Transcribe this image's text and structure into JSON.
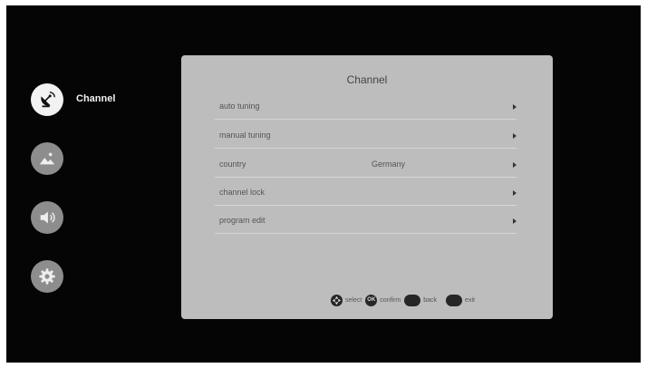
{
  "sidebar": {
    "items": [
      {
        "label": "Channel",
        "icon": "satellite-dish-icon",
        "active": true
      },
      {
        "label": "",
        "icon": "picture-icon",
        "active": false
      },
      {
        "label": "",
        "icon": "speaker-icon",
        "active": false
      },
      {
        "label": "",
        "icon": "gear-icon",
        "active": false
      }
    ]
  },
  "panel": {
    "title": "Channel",
    "rows": [
      {
        "label": "auto tuning",
        "value": ""
      },
      {
        "label": "manual tuning",
        "value": ""
      },
      {
        "label": "country",
        "value": "Germany"
      },
      {
        "label": "channel lock",
        "value": ""
      },
      {
        "label": "program edit",
        "value": ""
      }
    ]
  },
  "hints": {
    "select": {
      "key": "",
      "label": "select"
    },
    "confirm": {
      "key": "OK",
      "label": "confirm"
    },
    "back": {
      "key": "",
      "label": "back"
    },
    "exit": {
      "key": "",
      "label": "exit"
    }
  },
  "colors": {
    "background": "#050505",
    "panel": "#bdbdbd",
    "active_icon_bg": "#f2f2f2",
    "inactive_icon_bg": "#8d8d8d"
  }
}
